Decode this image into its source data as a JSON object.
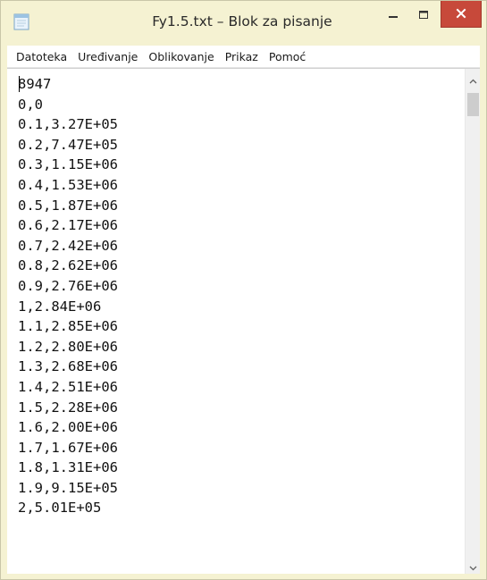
{
  "window": {
    "title": "Fy1.5.txt – Blok za pisanje",
    "frame_color": "#f5f2d2",
    "close_color": "#c7493a"
  },
  "menu": {
    "items": [
      {
        "label": "Datoteka"
      },
      {
        "label": "Uređivanje"
      },
      {
        "label": "Oblikovanje"
      },
      {
        "label": "Prikaz"
      },
      {
        "label": "Pomoć"
      }
    ]
  },
  "document": {
    "lines": [
      "8947",
      "0,0",
      "0.1,3.27E+05",
      "0.2,7.47E+05",
      "0.3,1.15E+06",
      "0.4,1.53E+06",
      "0.5,1.87E+06",
      "0.6,2.17E+06",
      "0.7,2.42E+06",
      "0.8,2.62E+06",
      "0.9,2.76E+06",
      "1,2.84E+06",
      "1.1,2.85E+06",
      "1.2,2.80E+06",
      "1.3,2.68E+06",
      "1.4,2.51E+06",
      "1.5,2.28E+06",
      "1.6,2.00E+06",
      "1.7,1.67E+06",
      "1.8,1.31E+06",
      "1.9,9.15E+05",
      "2,5.01E+05"
    ]
  },
  "icons": {
    "app": "notepad-icon",
    "minimize": "minimize-icon",
    "maximize": "maximize-icon",
    "close": "close-icon",
    "scroll_up": "chevron-up-icon",
    "scroll_down": "chevron-down-icon"
  }
}
